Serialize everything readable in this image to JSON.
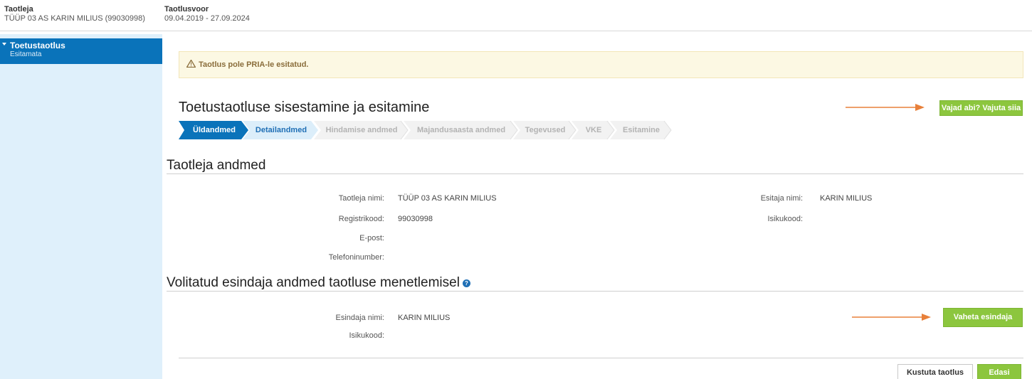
{
  "header": {
    "applicant_label": "Taotleja",
    "applicant_value": "TÜÜP 03 AS KARIN MILIUS (99030998)",
    "round_label": "Taotlusvoor",
    "round_value": "09.04.2019 - 27.09.2024"
  },
  "sidebar": {
    "items": [
      {
        "title": "Toetustaotlus",
        "subtitle": "Esitamata",
        "active": true
      }
    ]
  },
  "alert": {
    "icon": "warning-icon",
    "text": "Taotlus pole PRIA-le esitatud."
  },
  "page": {
    "title": "Toetustaotluse sisestamine ja esitamine",
    "help_button": "Vajad abi? Vajuta siia"
  },
  "steps": [
    {
      "label": "Üldandmed",
      "state": "active"
    },
    {
      "label": "Detailandmed",
      "state": "next"
    },
    {
      "label": "Hindamise andmed",
      "state": "disabled"
    },
    {
      "label": "Majandusaasta andmed",
      "state": "disabled"
    },
    {
      "label": "Tegevused",
      "state": "disabled"
    },
    {
      "label": "VKE",
      "state": "disabled"
    },
    {
      "label": "Esitamine",
      "state": "disabled"
    }
  ],
  "applicant_section": {
    "title": "Taotleja andmed",
    "fields_left": [
      {
        "label": "Taotleja nimi:",
        "value": "TÜÜP 03 AS KARIN MILIUS"
      },
      {
        "label": "Registrikood:",
        "value": "99030998"
      },
      {
        "label": "E-post:",
        "value": ""
      },
      {
        "label": "Telefoninumber:",
        "value": ""
      }
    ],
    "fields_right": [
      {
        "label": "Esitaja nimi:",
        "value": "KARIN MILIUS"
      },
      {
        "label": "Isikukood:",
        "value": ""
      }
    ]
  },
  "representative_section": {
    "title": "Volitatud esindaja andmed taotluse menetlemisel",
    "info_icon": "info-icon",
    "fields": [
      {
        "label": "Esindaja nimi:",
        "value": "KARIN MILIUS"
      },
      {
        "label": "Isikukood:",
        "value": ""
      }
    ],
    "change_button": "Vaheta esindaja"
  },
  "footer": {
    "delete_button": "Kustuta taotlus",
    "next_button": "Edasi"
  },
  "colors": {
    "primary_blue": "#0a73ba",
    "sidebar_bg": "#dff0fb",
    "green": "#8cc63e",
    "arrow_orange": "#e8803a",
    "alert_bg": "#fcf8e3",
    "alert_text": "#8a6d3b",
    "step_disabled": "#f0f0f0"
  }
}
